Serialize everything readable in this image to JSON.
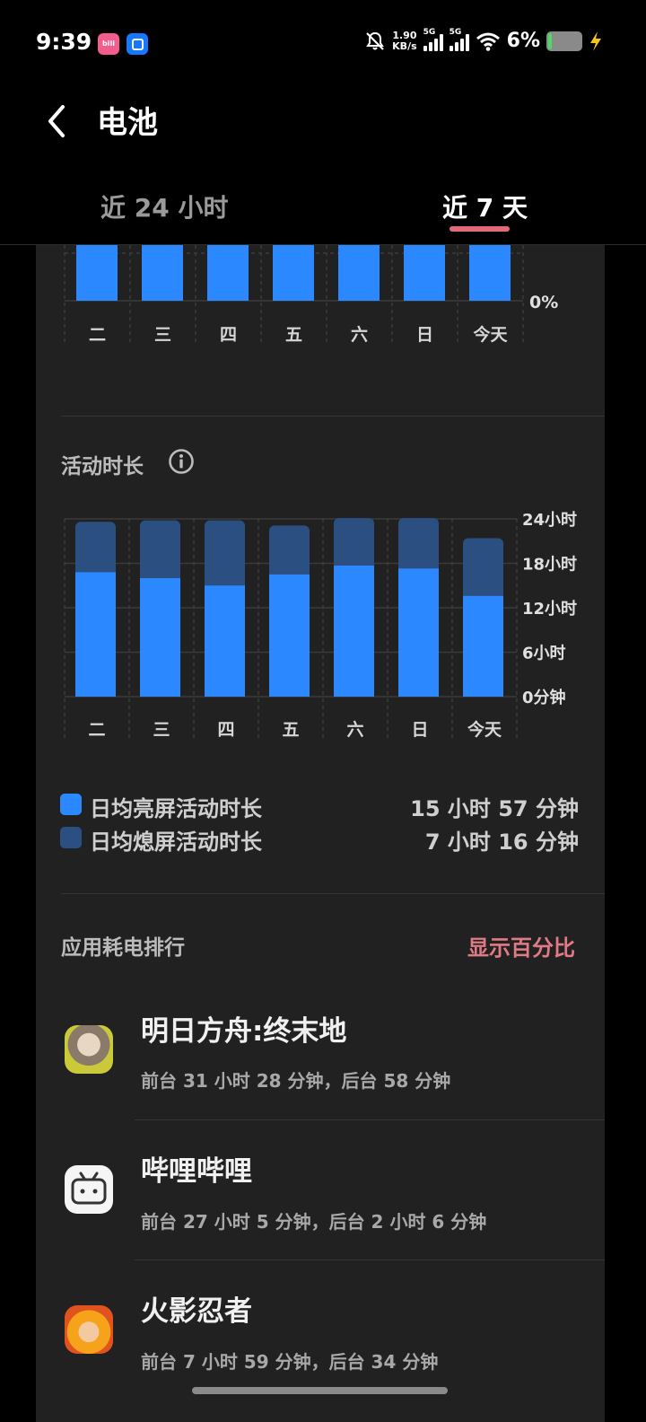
{
  "status_bar": {
    "time": "9:39",
    "net_speed_value": "1.90",
    "net_speed_unit": "KB/s",
    "signal1_label": "5G",
    "signal2_label": "5G",
    "battery_percent": "6%",
    "icons": [
      "bilibili-app-icon",
      "blue-app-icon",
      "mute-icon",
      "signal-icon",
      "signal-icon",
      "wifi-icon",
      "battery-icon",
      "charging-icon"
    ]
  },
  "header": {
    "title": "电池",
    "tabs": [
      {
        "label": "近 24 小时",
        "active": false
      },
      {
        "label": "近 7 天",
        "active": true
      }
    ]
  },
  "colors": {
    "screen_on": "#2b88ff",
    "screen_off": "#2c4f82",
    "accent": "#e07a85"
  },
  "battery_chart": {
    "y_label_bottom": "0%",
    "days": [
      "二",
      "三",
      "四",
      "五",
      "六",
      "日",
      "今天"
    ]
  },
  "activity": {
    "title": "活动时长",
    "y_labels": [
      "24小时",
      "18小时",
      "12小时",
      "6小时",
      "0分钟"
    ]
  },
  "chart_data": {
    "type": "bar",
    "stacked": true,
    "categories": [
      "二",
      "三",
      "四",
      "五",
      "六",
      "日",
      "今天"
    ],
    "series": [
      {
        "name": "日均亮屏活动时长",
        "values": [
          16.8,
          16.0,
          15.0,
          16.5,
          17.7,
          17.3,
          13.6
        ]
      },
      {
        "name": "日均熄屏活动时长",
        "values": [
          6.8,
          7.8,
          8.8,
          6.6,
          6.4,
          6.8,
          7.8
        ]
      }
    ],
    "ylim": [
      0,
      24
    ],
    "y_ticks": [
      "0分钟",
      "6小时",
      "12小时",
      "18小时",
      "24小时"
    ],
    "y_axis_side": "right",
    "grid": true
  },
  "legend": [
    {
      "label": "日均亮屏活动时长",
      "value": "15 小时 57 分钟"
    },
    {
      "label": "日均熄屏活动时长",
      "value": "7 小时 16 分钟"
    }
  ],
  "ranking": {
    "title": "应用耗电排行",
    "action": "显示百分比",
    "apps": [
      {
        "name": "明日方舟:终末地",
        "usage": "前台 31 小时 28 分钟，后台 58 分钟",
        "icon": "arknights-endfield-icon"
      },
      {
        "name": "哔哩哔哩",
        "usage": "前台 27 小时 5 分钟，后台 2 小时 6 分钟",
        "icon": "bilibili-icon"
      },
      {
        "name": "火影忍者",
        "usage": "前台 7 小时 59 分钟，后台 34 分钟",
        "icon": "naruto-icon"
      }
    ]
  },
  "bilibili_badge": "bili"
}
